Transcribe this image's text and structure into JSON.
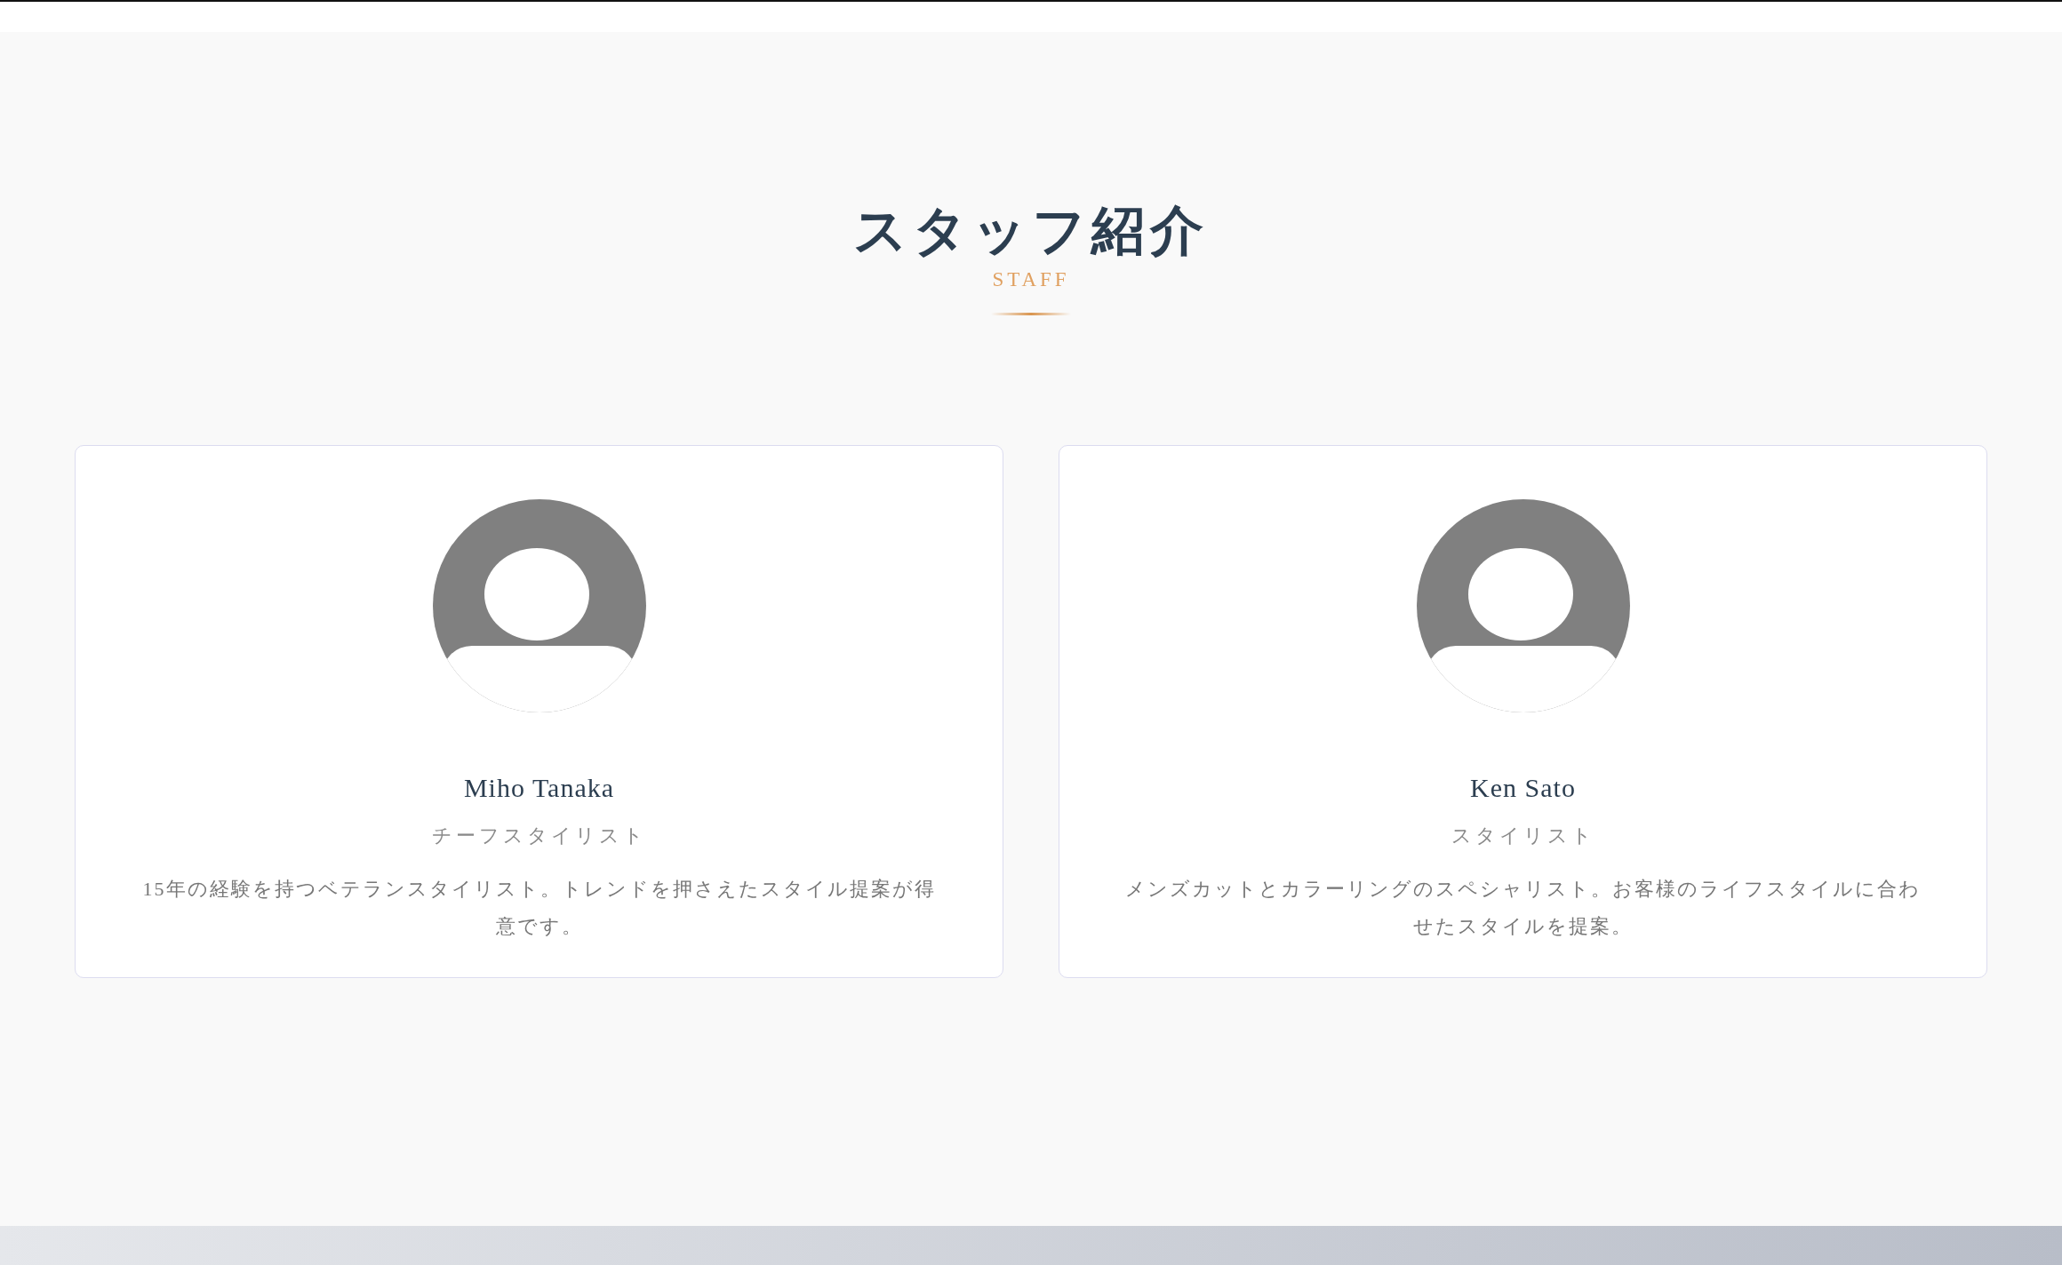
{
  "section": {
    "title": "スタッフ紹介",
    "subtitle": "STAFF"
  },
  "staff": [
    {
      "name": "Miho Tanaka",
      "role": "チーフスタイリスト",
      "description": "15年の経験を持つベテランスタイリスト。トレンドを押さえたスタイル提案が得意です。"
    },
    {
      "name": "Ken Sato",
      "role": "スタイリスト",
      "description": "メンズカットとカラーリングのスペシャリスト。お客様のライフスタイルに合わせたスタイルを提案。"
    }
  ]
}
